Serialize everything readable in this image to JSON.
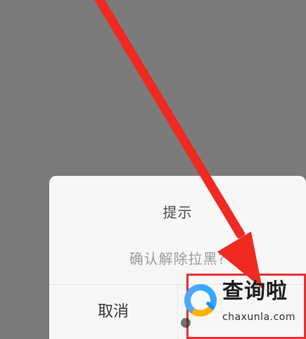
{
  "dialog": {
    "title": "提示",
    "message": "确认解除拉黑?",
    "cancel_label": "取消"
  },
  "watermark": {
    "main": "查询啦",
    "sub": "chaxunla.com",
    "logo_icon": "search-magnifier-icon"
  },
  "annotation": {
    "arrow_color": "#ef2a22",
    "box_color": "#e72f2f"
  }
}
